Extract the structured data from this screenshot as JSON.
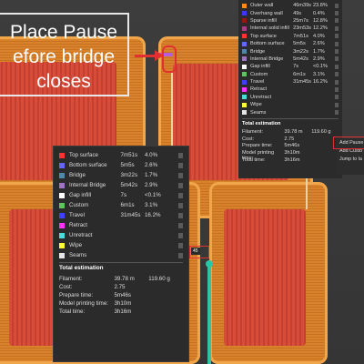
{
  "caption": {
    "line1": "Place Pause",
    "line2": "efore bridge",
    "line3": "closes"
  },
  "top_legend": {
    "rows": [
      {
        "name": "Outer wall",
        "time": "46m39s",
        "pct": "23.8%",
        "color": "#ff8c1a"
      },
      {
        "name": "Overhang wall",
        "time": "49s",
        "pct": "0.4%",
        "color": "#3f36ff"
      },
      {
        "name": "Sparse infill",
        "time": "25m7s",
        "pct": "12.8%",
        "color": "#8c1a1a"
      },
      {
        "name": "Internal solid infill",
        "time": "23m53s",
        "pct": "12.2%",
        "color": "#a83f87"
      },
      {
        "name": "Top surface",
        "time": "7m51s",
        "pct": "4.0%",
        "color": "#ff3333"
      },
      {
        "name": "Bottom surface",
        "time": "5m5s",
        "pct": "2.6%",
        "color": "#6666ff"
      },
      {
        "name": "Bridge",
        "time": "3m22s",
        "pct": "1.7%",
        "color": "#4f88a8"
      },
      {
        "name": "Internal Bridge",
        "time": "5m42s",
        "pct": "2.9%",
        "color": "#a074c4"
      },
      {
        "name": "Gap infill",
        "time": "7s",
        "pct": "<0.1%",
        "color": "#ffffff"
      },
      {
        "name": "Custom",
        "time": "6m1s",
        "pct": "3.1%",
        "color": "#5ec45e"
      },
      {
        "name": "Travel",
        "time": "31m45s",
        "pct": "16.2%",
        "color": "#4040ff"
      },
      {
        "name": "Retract",
        "time": "",
        "pct": "",
        "color": "#ff33ff"
      },
      {
        "name": "Unretract",
        "time": "",
        "pct": "",
        "color": "#4ddcdc"
      },
      {
        "name": "Wipe",
        "time": "",
        "pct": "",
        "color": "#ffff33"
      },
      {
        "name": "Seams",
        "time": "",
        "pct": "",
        "color": "#e6e6e6"
      }
    ],
    "totals_title": "Total estimation",
    "totals": [
      {
        "k": "Filament:",
        "v": "39.78 m",
        "v2": "119.60 g"
      },
      {
        "k": "Cost:",
        "v": "2.75",
        "v2": ""
      },
      {
        "k": "Prepare time:",
        "v": "5m46s",
        "v2": ""
      },
      {
        "k": "Model printing time:",
        "v": "3h10m",
        "v2": ""
      },
      {
        "k": "Total time:",
        "v": "3h16m",
        "v2": ""
      }
    ]
  },
  "big_legend": {
    "rows": [
      {
        "name": "Top surface",
        "time": "7m51s",
        "pct": "4.0%",
        "color": "#ff3333"
      },
      {
        "name": "Bottom surface",
        "time": "5m5s",
        "pct": "2.6%",
        "color": "#6666ff"
      },
      {
        "name": "Bridge",
        "time": "3m22s",
        "pct": "1.7%",
        "color": "#4f88a8"
      },
      {
        "name": "Internal Bridge",
        "time": "5m42s",
        "pct": "2.9%",
        "color": "#a074c4"
      },
      {
        "name": "Gap infill",
        "time": "7s",
        "pct": "<0.1%",
        "color": "#ffffff"
      },
      {
        "name": "Custom",
        "time": "6m1s",
        "pct": "3.1%",
        "color": "#5ec45e"
      },
      {
        "name": "Travel",
        "time": "31m45s",
        "pct": "16.2%",
        "color": "#4040ff"
      },
      {
        "name": "Retract",
        "time": "",
        "pct": "",
        "color": "#ff33ff"
      },
      {
        "name": "Unretract",
        "time": "",
        "pct": "",
        "color": "#4ddcdc"
      },
      {
        "name": "Wipe",
        "time": "",
        "pct": "",
        "color": "#ffff33"
      },
      {
        "name": "Seams",
        "time": "",
        "pct": "",
        "color": "#e6e6e6"
      }
    ],
    "totals_title": "Total estimation",
    "totals": [
      {
        "k": "Filament:",
        "v": "39.78 m",
        "v2": "119.60 g"
      },
      {
        "k": "Cost:",
        "v": "2.75",
        "v2": ""
      },
      {
        "k": "Prepare time:",
        "v": "5m46s",
        "v2": ""
      },
      {
        "k": "Model printing time:",
        "v": "3h10m",
        "v2": ""
      },
      {
        "k": "Total time:",
        "v": "3h16m",
        "v2": ""
      }
    ]
  },
  "context_menu": {
    "items": [
      "Add Pause",
      "Add Custo",
      "Jump to la"
    ]
  },
  "layer_slider": {
    "label": "45"
  },
  "colors": {
    "accent_red": "#e03030",
    "slider": "#2ec4a6",
    "panel_bg": "#2b2b2b"
  }
}
